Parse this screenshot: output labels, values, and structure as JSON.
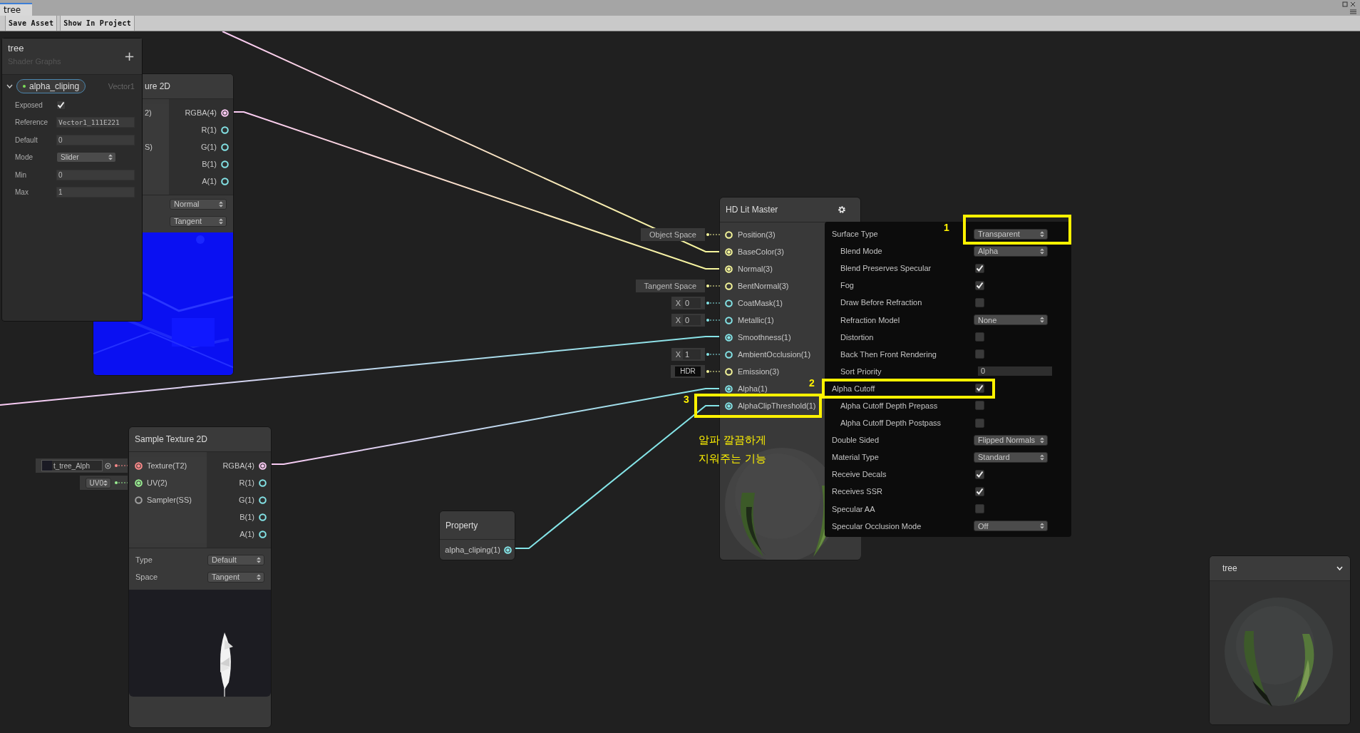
{
  "tab": {
    "title": "tree"
  },
  "toolbar": {
    "buttons": [
      "Save Asset",
      "Show In Project"
    ]
  },
  "blackboard": {
    "title": "tree",
    "subtitle": "Shader Graphs",
    "add": "+",
    "properties": [
      {
        "name": "alpha_cliping",
        "type": "Vector1",
        "expanded": true,
        "fields": [
          {
            "kind": "checkbox",
            "label": "Exposed",
            "checked": true
          },
          {
            "kind": "text",
            "label": "Reference",
            "value": "Vector1_111E221"
          },
          {
            "kind": "number",
            "label": "Default",
            "value": "0"
          },
          {
            "kind": "dropdown",
            "label": "Mode",
            "value": "Slider"
          },
          {
            "kind": "number",
            "label": "Min",
            "value": "0"
          },
          {
            "kind": "number",
            "label": "Max",
            "value": "1"
          }
        ]
      }
    ]
  },
  "partial_node": {
    "title": "ure 2D",
    "inputs": [
      "2)",
      "S)"
    ],
    "outputs": [
      {
        "label": "RGBA(4)",
        "color": "#fbcbf4",
        "connected": true
      },
      {
        "label": "R(1)",
        "color": "#84e4e7",
        "connected": false
      },
      {
        "label": "G(1)",
        "color": "#84e4e7",
        "connected": false
      },
      {
        "label": "B(1)",
        "color": "#84e4e7",
        "connected": false
      },
      {
        "label": "A(1)",
        "color": "#84e4e7",
        "connected": false
      }
    ],
    "dropdowns": [
      "Normal",
      "Tangent"
    ]
  },
  "master_node": {
    "title": "HD Lit Master",
    "ports": [
      {
        "label": "Position(3)",
        "color": "#f6f79a",
        "connected": false,
        "default": {
          "kind": "space",
          "value": "Object Space"
        }
      },
      {
        "label": "BaseColor(3)",
        "color": "#f6f79a",
        "connected": true
      },
      {
        "label": "Normal(3)",
        "color": "#f6f79a",
        "connected": true
      },
      {
        "label": "BentNormal(3)",
        "color": "#f6f79a",
        "connected": false,
        "default": {
          "kind": "space",
          "value": "Tangent Space"
        }
      },
      {
        "label": "CoatMask(1)",
        "color": "#84e4e7",
        "connected": false,
        "default": {
          "kind": "vector1",
          "axis": "X",
          "value": "0"
        }
      },
      {
        "label": "Metallic(1)",
        "color": "#84e4e7",
        "connected": false,
        "default": {
          "kind": "vector1",
          "axis": "X",
          "value": "0"
        }
      },
      {
        "label": "Smoothness(1)",
        "color": "#84e4e7",
        "connected": true
      },
      {
        "label": "AmbientOcclusion(1)",
        "color": "#84e4e7",
        "connected": false,
        "default": {
          "kind": "vector1",
          "axis": "X",
          "value": "1"
        }
      },
      {
        "label": "Emission(3)",
        "color": "#f6f79a",
        "connected": false,
        "default": {
          "kind": "color",
          "value": "HDR"
        }
      },
      {
        "label": "Alpha(1)",
        "color": "#84e4e7",
        "connected": true
      },
      {
        "label": "AlphaClipThreshold(1)",
        "color": "#84e4e7",
        "connected": true,
        "marker": {
          "number": "3"
        }
      }
    ]
  },
  "settings": [
    {
      "label": "Surface Type",
      "kind": "dropdown",
      "value": "Transparent",
      "marker": {
        "number": "1"
      },
      "children": [
        {
          "label": "Blend Mode",
          "kind": "dropdown",
          "value": "Alpha"
        },
        {
          "label": "Blend Preserves Specular",
          "kind": "checkbox",
          "checked": true
        },
        {
          "label": "Fog",
          "kind": "checkbox",
          "checked": true
        },
        {
          "label": "Draw Before Refraction",
          "kind": "checkbox",
          "checked": false
        },
        {
          "label": "Refraction Model",
          "kind": "dropdown",
          "value": "None"
        },
        {
          "label": "Distortion",
          "kind": "checkbox",
          "checked": false
        },
        {
          "label": "Back Then Front Rendering",
          "kind": "checkbox",
          "checked": false
        },
        {
          "label": "Sort Priority",
          "kind": "number",
          "value": "0"
        }
      ]
    },
    {
      "label": "Alpha Cutoff",
      "kind": "checkbox",
      "checked": true,
      "marker": {
        "number": "2"
      },
      "children": [
        {
          "label": "Alpha Cutoff Depth Prepass",
          "kind": "checkbox",
          "checked": false
        },
        {
          "label": "Alpha Cutoff Depth Postpass",
          "kind": "checkbox",
          "checked": false
        }
      ]
    },
    {
      "label": "Double Sided",
      "kind": "dropdown",
      "value": "Flipped Normals"
    },
    {
      "label": "Material Type",
      "kind": "dropdown",
      "value": "Standard"
    },
    {
      "label": "Receive Decals",
      "kind": "checkbox",
      "checked": true
    },
    {
      "label": "Receives SSR",
      "kind": "checkbox",
      "checked": true
    },
    {
      "label": "Specular AA",
      "kind": "checkbox",
      "checked": false
    },
    {
      "label": "Specular Occlusion Mode",
      "kind": "dropdown",
      "value": "Off"
    }
  ],
  "note": {
    "lines": [
      "알파 깔끔하게",
      "지워주는 기능"
    ]
  },
  "sample_node": {
    "title": "Sample Texture 2D",
    "inputs": [
      {
        "label": "Texture(T2)",
        "color": "#ff8b8b",
        "connected": true,
        "default": {
          "kind": "texture",
          "value": "t_tree_Alph"
        }
      },
      {
        "label": "UV(2)",
        "color": "#9aef92",
        "connected": true,
        "default": {
          "kind": "dropdown",
          "value": "UV0"
        }
      },
      {
        "label": "Sampler(SS)",
        "color": "#a0a0a0",
        "connected": false
      }
    ],
    "outputs": [
      {
        "label": "RGBA(4)",
        "color": "#fbcbf4",
        "connected": true
      },
      {
        "label": "R(1)",
        "color": "#84e4e7",
        "connected": false
      },
      {
        "label": "G(1)",
        "color": "#84e4e7",
        "connected": false
      },
      {
        "label": "B(1)",
        "color": "#84e4e7",
        "connected": false
      },
      {
        "label": "A(1)",
        "color": "#84e4e7",
        "connected": false
      }
    ],
    "fields": [
      {
        "label": "Type",
        "value": "Default"
      },
      {
        "label": "Space",
        "value": "Tangent"
      }
    ]
  },
  "property_node": {
    "title": "Property",
    "outputs": [
      {
        "label": "alpha_cliping(1)",
        "color": "#84e4e7",
        "connected": true
      }
    ]
  },
  "preview": {
    "title": "tree"
  }
}
